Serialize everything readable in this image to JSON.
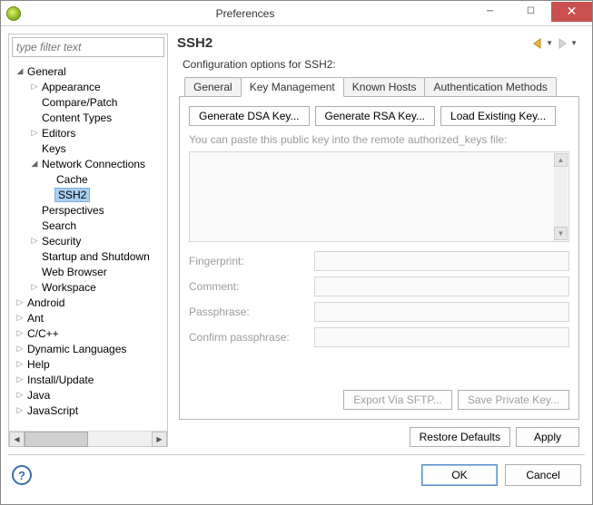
{
  "window": {
    "title": "Preferences"
  },
  "filter": {
    "placeholder": "type filter text"
  },
  "tree": {
    "items": [
      {
        "label": "General",
        "indent": 0,
        "arrow": "open"
      },
      {
        "label": "Appearance",
        "indent": 1,
        "arrow": "closed"
      },
      {
        "label": "Compare/Patch",
        "indent": 1,
        "arrow": "none"
      },
      {
        "label": "Content Types",
        "indent": 1,
        "arrow": "none"
      },
      {
        "label": "Editors",
        "indent": 1,
        "arrow": "closed"
      },
      {
        "label": "Keys",
        "indent": 1,
        "arrow": "none"
      },
      {
        "label": "Network Connections",
        "indent": 1,
        "arrow": "open"
      },
      {
        "label": "Cache",
        "indent": 2,
        "arrow": "none"
      },
      {
        "label": "SSH2",
        "indent": 2,
        "arrow": "none",
        "selected": true
      },
      {
        "label": "Perspectives",
        "indent": 1,
        "arrow": "none"
      },
      {
        "label": "Search",
        "indent": 1,
        "arrow": "none"
      },
      {
        "label": "Security",
        "indent": 1,
        "arrow": "closed"
      },
      {
        "label": "Startup and Shutdown",
        "indent": 1,
        "arrow": "none"
      },
      {
        "label": "Web Browser",
        "indent": 1,
        "arrow": "none"
      },
      {
        "label": "Workspace",
        "indent": 1,
        "arrow": "closed"
      },
      {
        "label": "Android",
        "indent": 0,
        "arrow": "closed"
      },
      {
        "label": "Ant",
        "indent": 0,
        "arrow": "closed"
      },
      {
        "label": "C/C++",
        "indent": 0,
        "arrow": "closed"
      },
      {
        "label": "Dynamic Languages",
        "indent": 0,
        "arrow": "closed"
      },
      {
        "label": "Help",
        "indent": 0,
        "arrow": "closed"
      },
      {
        "label": "Install/Update",
        "indent": 0,
        "arrow": "closed"
      },
      {
        "label": "Java",
        "indent": 0,
        "arrow": "closed"
      },
      {
        "label": "JavaScript",
        "indent": 0,
        "arrow": "closed"
      }
    ]
  },
  "page": {
    "title": "SSH2",
    "description": "Configuration options for SSH2:"
  },
  "tabs": {
    "items": [
      {
        "label": "General"
      },
      {
        "label": "Key Management",
        "active": true
      },
      {
        "label": "Known Hosts"
      },
      {
        "label": "Authentication Methods"
      }
    ]
  },
  "keymgmt": {
    "gen_dsa": "Generate DSA Key...",
    "gen_rsa": "Generate RSA Key...",
    "load_key": "Load Existing Key...",
    "paste_hint": "You can paste this public key into the remote authorized_keys file:",
    "fingerprint_label": "Fingerprint:",
    "comment_label": "Comment:",
    "passphrase_label": "Passphrase:",
    "confirm_label": "Confirm passphrase:",
    "export_sftp": "Export Via SFTP...",
    "save_private": "Save Private Key..."
  },
  "footer": {
    "restore": "Restore Defaults",
    "apply": "Apply"
  },
  "bottom": {
    "ok": "OK",
    "cancel": "Cancel"
  }
}
